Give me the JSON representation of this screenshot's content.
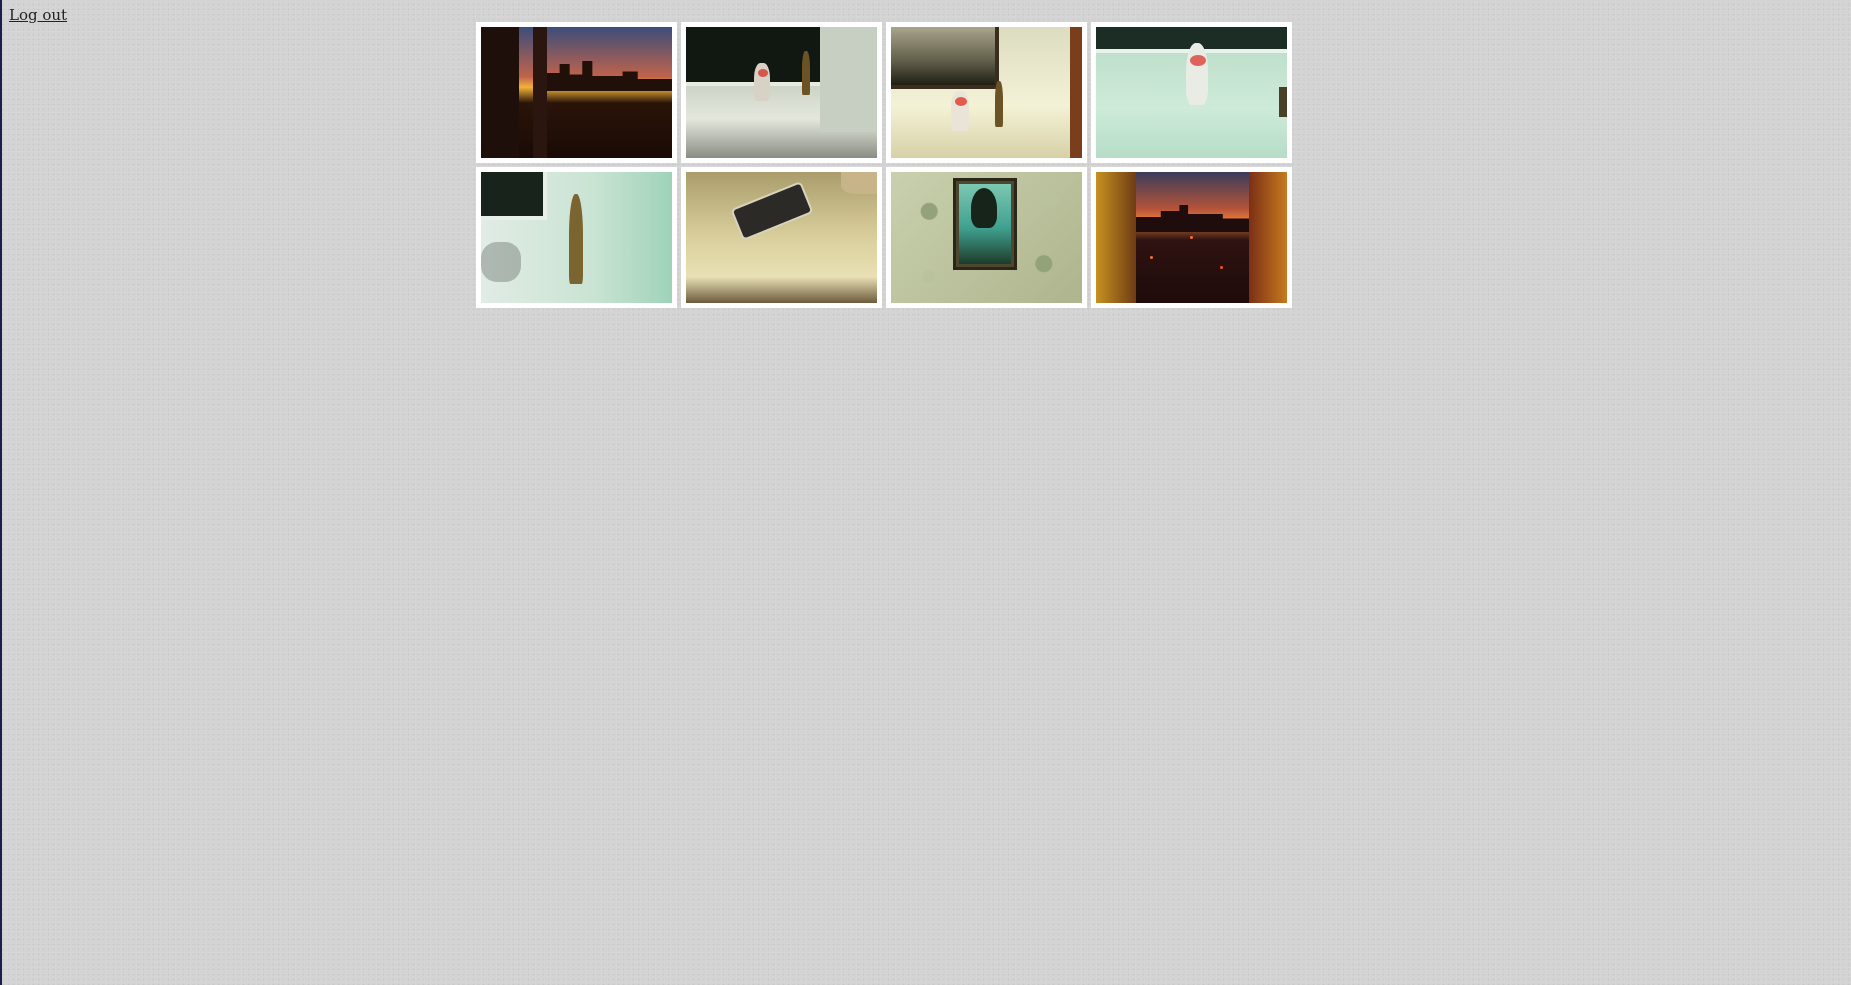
{
  "header": {
    "logout_label": "Log out"
  },
  "gallery": {
    "photos": [
      {
        "icon": "sunset-window-photo"
      },
      {
        "icon": "figurines-dark-window-photo"
      },
      {
        "icon": "figurines-sill-photo"
      },
      {
        "icon": "cat-figurine-photo"
      },
      {
        "icon": "buddha-statue-photo"
      },
      {
        "icon": "phone-on-sill-photo"
      },
      {
        "icon": "framed-painting-photo"
      },
      {
        "icon": "sunset-city-photo"
      }
    ]
  },
  "colors": {
    "background": "#d3d3d3",
    "thumb_border": "#ffffff",
    "link": "#222222"
  }
}
